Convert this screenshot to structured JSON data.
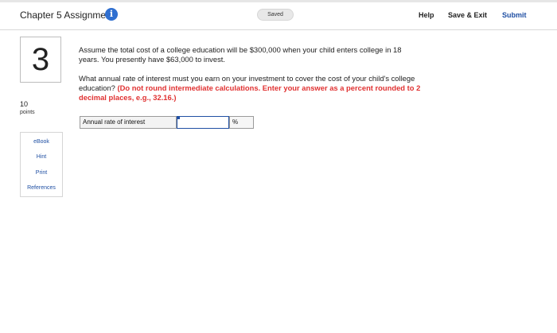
{
  "header": {
    "title": "Chapter 5 Assignment",
    "info_icon": "i",
    "status": "Saved",
    "help_label": "Help",
    "save_exit_label": "Save & Exit",
    "submit_label": "Submit"
  },
  "question": {
    "number": "3",
    "points_value": "10",
    "points_label": "points",
    "paragraph1": "Assume the total cost of a college education will be $300,000 when your child enters college in 18 years. You presently have $63,000 to invest.",
    "paragraph2_text": "What annual rate of interest must you earn on your investment to cover the cost of your child's college education? ",
    "paragraph2_instruction": "(Do not round intermediate calculations. Enter your answer as a percent rounded to 2 decimal places, e.g., 32.16.)"
  },
  "answer": {
    "label": "Annual rate of interest",
    "value": "",
    "unit": "%"
  },
  "sidebar_links": {
    "ebook": "eBook",
    "hint": "Hint",
    "print": "Print",
    "references": "References"
  },
  "colors": {
    "accent": "#1f4fa3",
    "info_icon": "#2f6fd0",
    "instruction": "#e03131"
  }
}
